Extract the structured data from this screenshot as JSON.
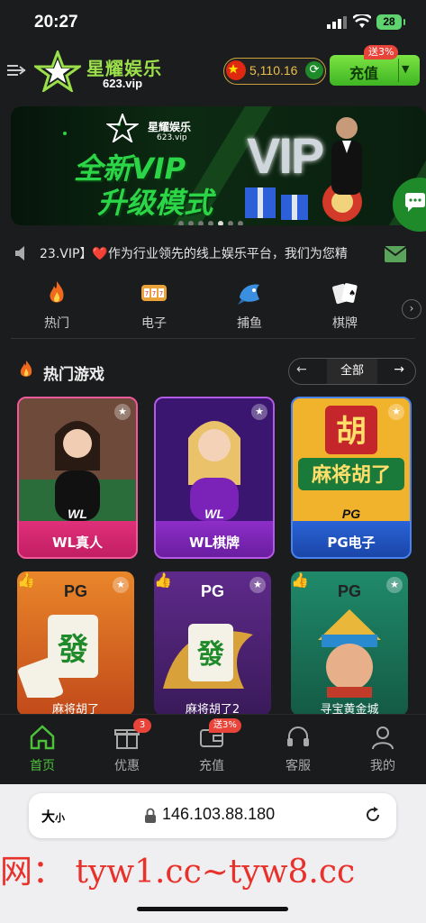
{
  "status_bar": {
    "time": "20:27",
    "battery": "28"
  },
  "header": {
    "brand_name": "星耀娱乐",
    "brand_domain": "623.vip",
    "balance": "5,110.16",
    "recharge_label": "充值",
    "recharge_promo": "送3%"
  },
  "banner": {
    "logo_name": "星耀娱乐",
    "logo_domain": "623.vip",
    "headline": "全新VIP",
    "subline": "升级模式",
    "vip_text": "VIP"
  },
  "marquee": {
    "text": "23.VIP】❤️作为行业领先的线上娱乐平台，我们为您精"
  },
  "categories": [
    {
      "label": "热门",
      "icon": "fire-icon"
    },
    {
      "label": "电子",
      "icon": "slot-machine-icon"
    },
    {
      "label": "捕鱼",
      "icon": "fish-icon"
    },
    {
      "label": "棋牌",
      "icon": "playing-cards-icon"
    }
  ],
  "section": {
    "title": "热门游戏",
    "all_label": "全部"
  },
  "games_row1": [
    {
      "name": "WL真人",
      "provider": "WL",
      "color": "#e0307a"
    },
    {
      "name": "WL棋牌",
      "provider": "WL",
      "color": "#8e2ec9"
    },
    {
      "name": "PG电子",
      "provider": "PG",
      "color": "#2a63d6"
    }
  ],
  "games_row2": [
    {
      "name": "麻将胡了",
      "provider": "PG"
    },
    {
      "name": "麻将胡了2",
      "provider": "PG"
    },
    {
      "name": "寻宝黄金城",
      "provider": "PG"
    }
  ],
  "tabbar": [
    {
      "label": "首页",
      "icon": "home-icon",
      "active": true
    },
    {
      "label": "优惠",
      "icon": "gift-icon",
      "badge": "3"
    },
    {
      "label": "充值",
      "icon": "wallet-icon",
      "badge": "送3%"
    },
    {
      "label": "客服",
      "icon": "headset-icon"
    },
    {
      "label": "我的",
      "icon": "user-icon"
    }
  ],
  "browser": {
    "text_size": "大",
    "text_size_small": "小",
    "url": "146.103.88.180"
  },
  "watermark": "网： tyw1.cc~tyw8.cc",
  "colors": {
    "accent": "#4bc23a",
    "gold": "#e8c04e",
    "badge": "#e8443a"
  }
}
